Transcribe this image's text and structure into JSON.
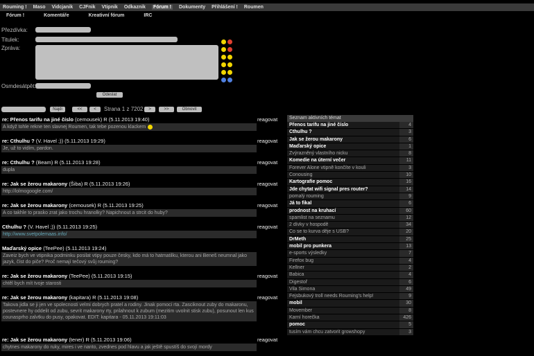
{
  "nav": [
    "Rouming !",
    "Maso",
    "Vidcjanik",
    "CJFnik",
    "Vtipnik",
    "Odkaznik",
    "Fórum !",
    "Dokumenty",
    "Přihlášení !",
    "Roumen"
  ],
  "nav_active": 6,
  "subnav": [
    "Fórum !",
    "Komentáře",
    "Kreativní fórum",
    "IRC"
  ],
  "form": {
    "nick_label": "Přezdívka:",
    "title_label": "Titulek:",
    "message_label": "Zpráva:",
    "code_label": "Osmdesátpět:",
    "submit": "Odeslat"
  },
  "pager": {
    "find": "Najdi",
    "first": "<<",
    "prev": "<",
    "page_text": "Strana 1 z 7202",
    "next": ">",
    "last": ">>",
    "refresh": "Obnovit"
  },
  "posts": [
    {
      "title": "re: Přenos tarifu na jiné číslo",
      "author": "(cemousek) R (5.11.2013 19:40)",
      "reply": "reagovat",
      "body": "A když tohle rekne ten slavnej Roumen, tak tebe pozenou klackem",
      "smile": true
    },
    {
      "title": "re: Cthulhu ?",
      "author": "(V. Havel ;)) (5.11.2013 19:29)",
      "reply": "reagovat",
      "body": "Je, už to vidím, pardon."
    },
    {
      "title": "re: Cthulhu ?",
      "author": "(Beam) R (5.11.2013 19:28)",
      "reply": "reagovat",
      "body": "dupla"
    },
    {
      "title": "re: Jak se žerou makarony",
      "author": "(Šiba) R (5.11.2013 19:26)",
      "reply": "reagovat",
      "body": "http://lolmogoogle.com/"
    },
    {
      "title": "re: Jak se žerou makarony",
      "author": "(cemousek) R (5.11.2013 19:25)",
      "reply": "reagovat",
      "body": "A co takhle to prasko zrat jako trochu hranolky? Napichnout a strcit do huby?"
    },
    {
      "title": "Cthulhu ?",
      "author": "(V. Havel ;)) (5.11.2013 19:25)",
      "reply": "reagovat",
      "body": "http://www.svetpolemaas.info/",
      "link": true
    },
    {
      "title": "Maďarský opice",
      "author": "(TeePee) (5.11.2013 19:24)",
      "reply": "",
      "body": "Zaveiz bych ve vtipnika podminku posilat vtipy pouze česky, kdo má to hatmatilku, kterou ani Beneš neumnal jako jazyk, číst do piče? Proč nemají tečový svůj rouming?",
      "tall": true
    },
    {
      "title": "re: Jak se žerou makarony",
      "author": "(TeePee) (5.11.2013 19:15)",
      "reply": "reagovat",
      "body": "chtěl bych mít tvoje starosti"
    },
    {
      "title": "re: Jak se žerou makarony",
      "author": "(kapitara) R (5.11.2013 19:08)",
      "reply": "reagovat",
      "body": "Takova jidla se ji jen ve spolecnosti velmi dobrych pratel a rodiny. Jinak pomoci rta. Zasciknout zuby do makaronu, postevnere hy oddelit od zubu, sevrit makarony rty, prilahnout k zubum (mezitim uvolnit stisk zubu), posunout len kus counasprho zalvtku do pusy, opakovat. EDIT: kapitara - 05.11.2013 19:11:03",
      "huge": true
    },
    {
      "title": "re: Jak se žerou makarony",
      "author": "(tener) R (5.11.2013 19:06)",
      "reply": "reagovat",
      "body": "chytnes makarony do ruky, mires i ve nanto, zvednes pod hlavu a jak ještě spustíš do svojí mordy"
    }
  ],
  "sidebar": {
    "title": "Seznam aktivních témat",
    "items": [
      {
        "name": "Přenos tarifu na jiné číslo",
        "count": "4",
        "bold": true
      },
      {
        "name": "Cthulhu ?",
        "count": "3",
        "bold": true
      },
      {
        "name": "Jak se žerou makarony",
        "count": "6",
        "bold": true
      },
      {
        "name": "Maďarský opice",
        "count": "1",
        "bold": true
      },
      {
        "name": "Zvýrazněný vlastního nicku",
        "count": "8",
        "bold": false
      },
      {
        "name": "Komedie na úterní večer",
        "count": "11",
        "bold": true
      },
      {
        "name": "Forever Alone vtipně končíte v kouli",
        "count": "3",
        "bold": false
      },
      {
        "name": "Conousing",
        "count": "10",
        "bold": false
      },
      {
        "name": "Kartografie pomoc",
        "count": "16",
        "bold": true
      },
      {
        "name": "Jde chytat wifi signal pres router?",
        "count": "14",
        "bold": true
      },
      {
        "name": "pomalý rouming",
        "count": "9",
        "bold": false
      },
      {
        "name": "Já to fikal",
        "count": "6",
        "bold": true
      },
      {
        "name": "prodnost na kruhací",
        "count": "60",
        "bold": true
      },
      {
        "name": "spamlist na seznamu",
        "count": "12",
        "bold": false
      },
      {
        "name": "2 dívky v hospodě",
        "count": "34",
        "bold": false
      },
      {
        "name": "Co se to kurva děje s USB?",
        "count": "20",
        "bold": false
      },
      {
        "name": "DrMeth",
        "count": "25",
        "bold": true
      },
      {
        "name": "mobil pro punkera",
        "count": "13",
        "bold": true
      },
      {
        "name": "e-sports výsledky",
        "count": "7",
        "bold": false
      },
      {
        "name": "Firefox bug",
        "count": "4",
        "bold": false
      },
      {
        "name": "Kellner",
        "count": "2",
        "bold": false
      },
      {
        "name": "Babica",
        "count": "4",
        "bold": false
      },
      {
        "name": "Digestoř",
        "count": "6",
        "bold": false
      },
      {
        "name": "Vila Simona",
        "count": "49",
        "bold": false
      },
      {
        "name": "Fejsbukový troll needs Rouming's help!",
        "count": "9",
        "bold": false
      },
      {
        "name": "mobil",
        "count": "30",
        "bold": true
      },
      {
        "name": "Movember",
        "count": "8",
        "bold": false
      },
      {
        "name": "Karní horečka",
        "count": "426",
        "bold": false
      },
      {
        "name": "pomoc",
        "count": "5",
        "bold": true
      },
      {
        "name": "tusím vám chcu zatvorit growshopy",
        "count": "3",
        "bold": false
      }
    ]
  }
}
